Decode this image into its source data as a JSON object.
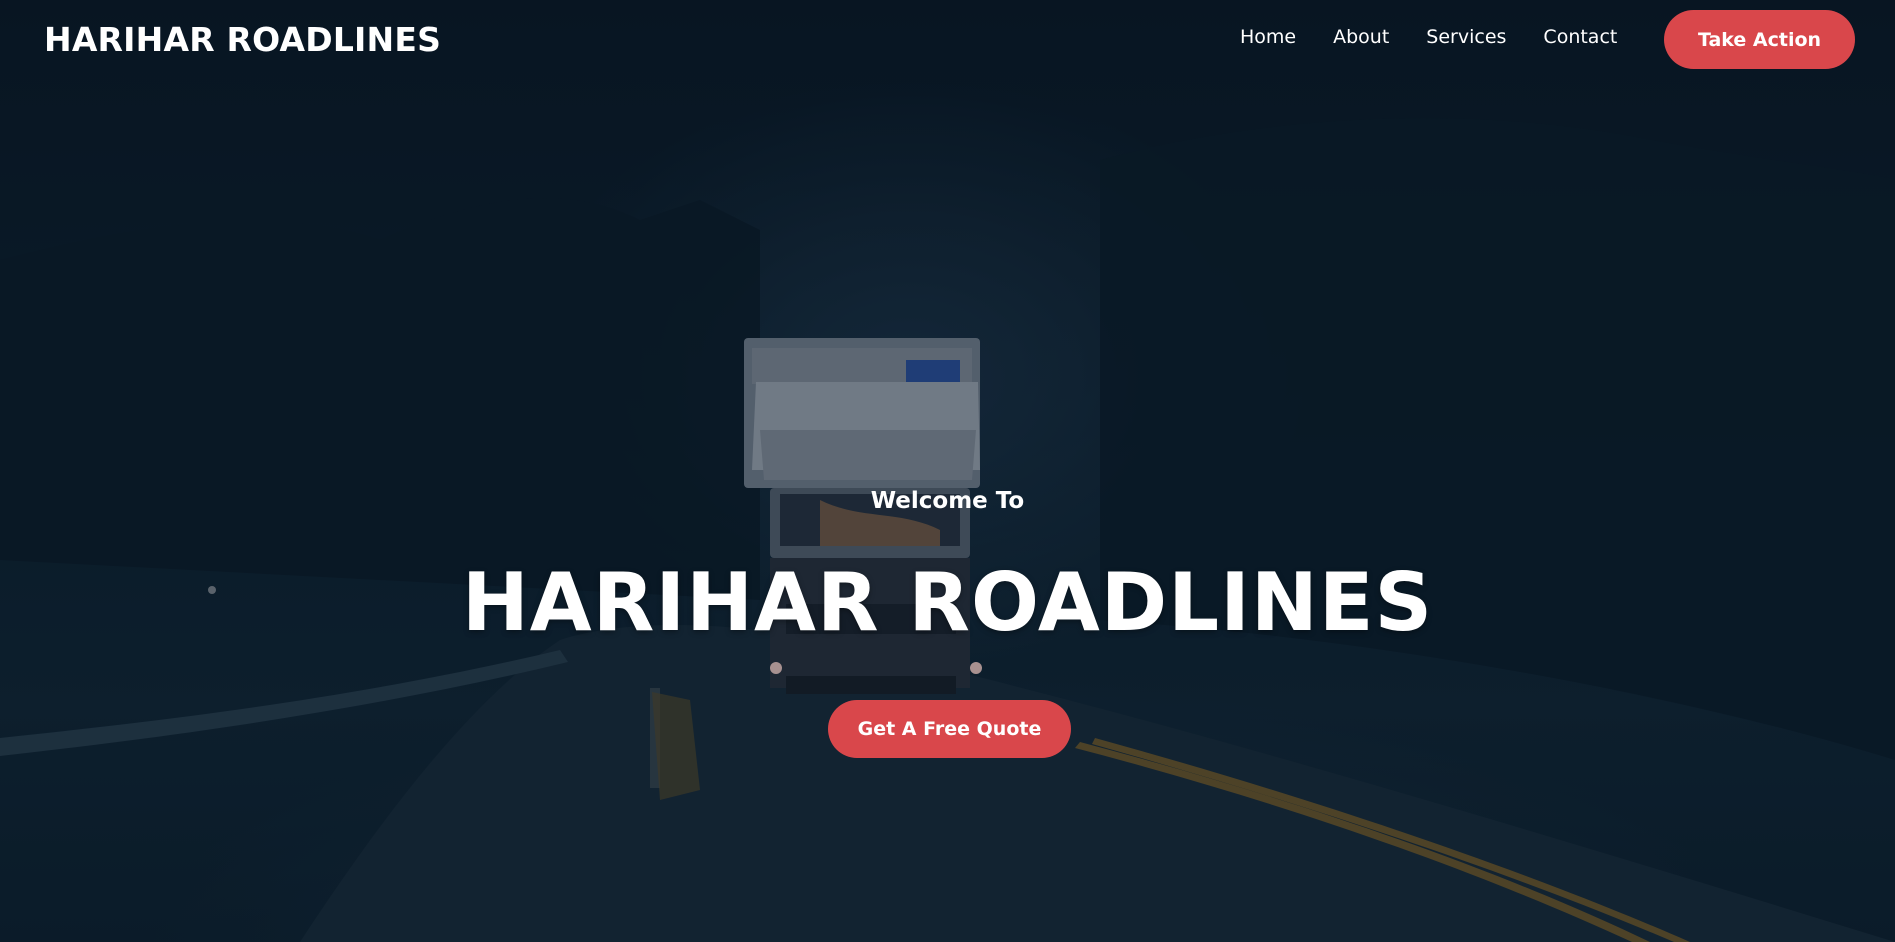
{
  "header": {
    "brand": "HARIHAR ROADLINES",
    "nav": [
      "Home",
      "About",
      "Services",
      "Contact"
    ],
    "cta_label": "Take Action"
  },
  "hero": {
    "kicker": "Welcome To",
    "title": "HARIHAR ROADLINES",
    "button_label": "Get A Free Quote",
    "background_image": "truck-on-dark-mountain-road"
  },
  "colors": {
    "accent": "#d9474b",
    "text": "#ffffff",
    "background": "#0b1c29"
  }
}
